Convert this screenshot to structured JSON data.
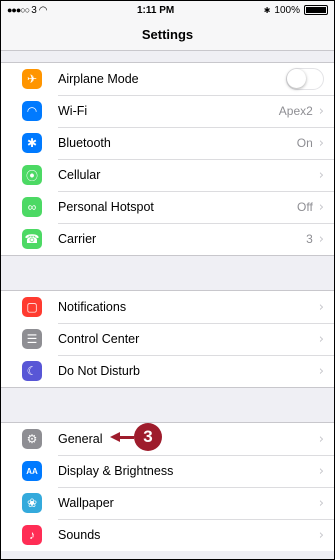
{
  "status": {
    "carrier": "3",
    "time": "1:11 PM",
    "battery": "100%",
    "bluetooth_symbol": "✱"
  },
  "navbar": {
    "title": "Settings"
  },
  "groups": {
    "connectivity": [
      {
        "label": "Airplane Mode",
        "value": "",
        "icon": "airplane-icon",
        "color": "#ff9500",
        "glyph": "✈",
        "toggle": true,
        "toggle_on": false
      },
      {
        "label": "Wi-Fi",
        "value": "Apex2",
        "icon": "wifi-icon",
        "color": "#007aff",
        "glyph": "◠"
      },
      {
        "label": "Bluetooth",
        "value": "On",
        "icon": "bluetooth-icon",
        "color": "#007aff",
        "glyph": "✱"
      },
      {
        "label": "Cellular",
        "value": "",
        "icon": "cellular-icon",
        "color": "#4cd964",
        "glyph": "⦿"
      },
      {
        "label": "Personal Hotspot",
        "value": "Off",
        "icon": "hotspot-icon",
        "color": "#4cd964",
        "glyph": "∞"
      },
      {
        "label": "Carrier",
        "value": "3",
        "icon": "phone-icon",
        "color": "#4cd964",
        "glyph": "☎"
      }
    ],
    "notifications": [
      {
        "label": "Notifications",
        "icon": "notifications-icon",
        "color": "#ff3b30",
        "glyph": "▢"
      },
      {
        "label": "Control Center",
        "icon": "control-center-icon",
        "color": "#8e8e93",
        "glyph": "☰"
      },
      {
        "label": "Do Not Disturb",
        "icon": "moon-icon",
        "color": "#5856d6",
        "glyph": "☾"
      }
    ],
    "general": [
      {
        "label": "General",
        "icon": "gear-icon",
        "color": "#8e8e93",
        "glyph": "⚙"
      },
      {
        "label": "Display & Brightness",
        "icon": "display-icon",
        "color": "#007aff",
        "glyph": "AA"
      },
      {
        "label": "Wallpaper",
        "icon": "wallpaper-icon",
        "color": "#34aadc",
        "glyph": "❀"
      },
      {
        "label": "Sounds",
        "icon": "speaker-icon",
        "color": "#ff2d55",
        "glyph": "♪"
      }
    ]
  },
  "callout": {
    "number": "3",
    "color": "#9e1c2c"
  },
  "chevron": "›"
}
